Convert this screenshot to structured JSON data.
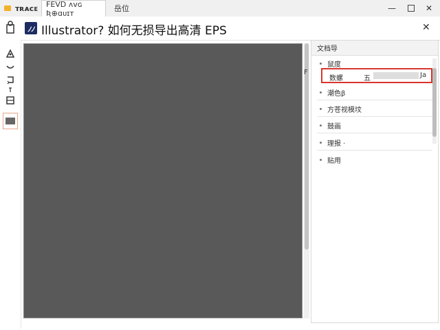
{
  "tabs": [
    {
      "label": "ᴛʀᴀᴄᴇ"
    },
    {
      "label": "FEVD ᴧᴠɢ Ʀ⊕ɑᴜɪᴛ"
    },
    {
      "label": "岳位"
    }
  ],
  "window": {
    "minimize": "—",
    "close": "✕"
  },
  "titlebar": {
    "title": "Illustrator? 如何无损导出高清 EPS",
    "close": "✕"
  },
  "panel": {
    "header": "文档导",
    "items": [
      {
        "label": "鼠度"
      },
      {
        "label": "潮色β"
      },
      {
        "label": "方苍视模坟"
      },
      {
        "label": "鼓画"
      },
      {
        "label": "理报 ·"
      },
      {
        "label": "贴用"
      }
    ],
    "selected": {
      "marker": "F",
      "label": "数螺",
      "mid": "五",
      "end": "Ja"
    }
  },
  "colors": {
    "accent": "#d9342b",
    "canvas": "#595959",
    "folder": "#f2b12a"
  }
}
